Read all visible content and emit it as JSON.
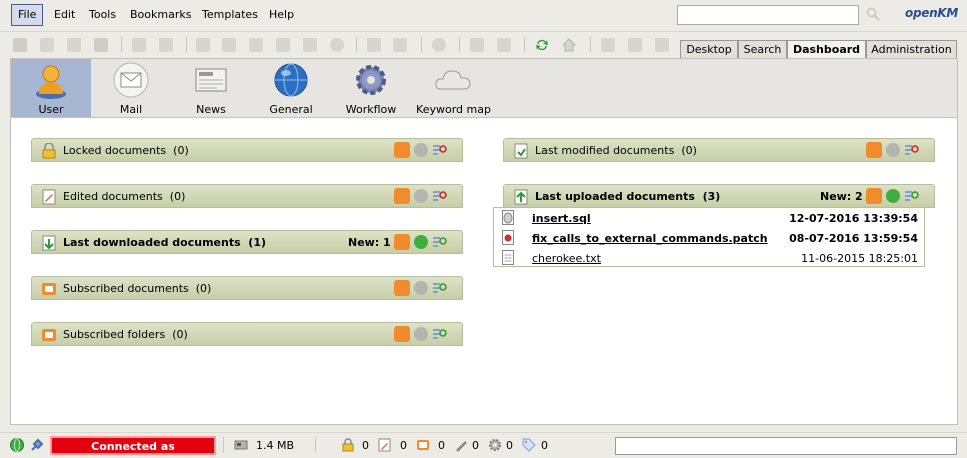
{
  "menu": {
    "items": [
      "File",
      "Edit",
      "Tools",
      "Bookmarks",
      "Templates",
      "Help"
    ],
    "active": "File"
  },
  "search": {
    "value": "",
    "placeholder": ""
  },
  "logo": {
    "main": "penKM",
    "prefix": "o"
  },
  "tabs": [
    {
      "label": "Desktop",
      "active": false
    },
    {
      "label": "Search",
      "active": false
    },
    {
      "label": "Dashboard",
      "active": true
    },
    {
      "label": "Administration",
      "active": false
    }
  ],
  "ribbon": {
    "items": [
      {
        "label": "User",
        "icon": "user-icon",
        "active": true
      },
      {
        "label": "Mail",
        "icon": "mail-icon",
        "active": false
      },
      {
        "label": "News",
        "icon": "news-icon",
        "active": false
      },
      {
        "label": "General",
        "icon": "globe-icon",
        "active": false
      },
      {
        "label": "Workflow",
        "icon": "gear-icon",
        "active": false
      },
      {
        "label": "Keyword map",
        "icon": "cloud-icon",
        "active": false
      }
    ]
  },
  "widgets": {
    "locked": {
      "title": "Locked documents",
      "count": "(0)",
      "new": ""
    },
    "edited": {
      "title": "Edited documents",
      "count": "(0)",
      "new": ""
    },
    "downloaded": {
      "title": "Last downloaded documents",
      "count": "(1)",
      "new": "New: 1"
    },
    "subscribed_docs": {
      "title": "Subscribed documents",
      "count": "(0)",
      "new": ""
    },
    "subscribed_folders": {
      "title": "Subscribed folders",
      "count": "(0)",
      "new": ""
    },
    "modified": {
      "title": "Last modified documents",
      "count": "(0)",
      "new": ""
    },
    "uploaded": {
      "title": "Last uploaded documents",
      "count": "(3)",
      "new": "New: 2",
      "rows": [
        {
          "name": "insert.sql",
          "date": "12-07-2016 13:39:54",
          "bold": true,
          "icon": "sql-file-icon"
        },
        {
          "name": "fix_calls_to_external_commands.patch",
          "date": "08-07-2016 13:59:54",
          "bold": true,
          "icon": "patch-file-icon"
        },
        {
          "name": "cherokee.txt",
          "date": "11-06-2015 18:25:01",
          "bold": false,
          "icon": "text-file-icon"
        }
      ]
    }
  },
  "status": {
    "connection": "Connected as Administrator",
    "size": "1.4 MB",
    "counts": [
      "0",
      "0",
      "0",
      "0",
      "0",
      "0"
    ]
  },
  "colors": {
    "accent": "#a6b6d3",
    "header": "#c7cea8",
    "rss": "#f08c2c",
    "connected": "#e3000f"
  }
}
